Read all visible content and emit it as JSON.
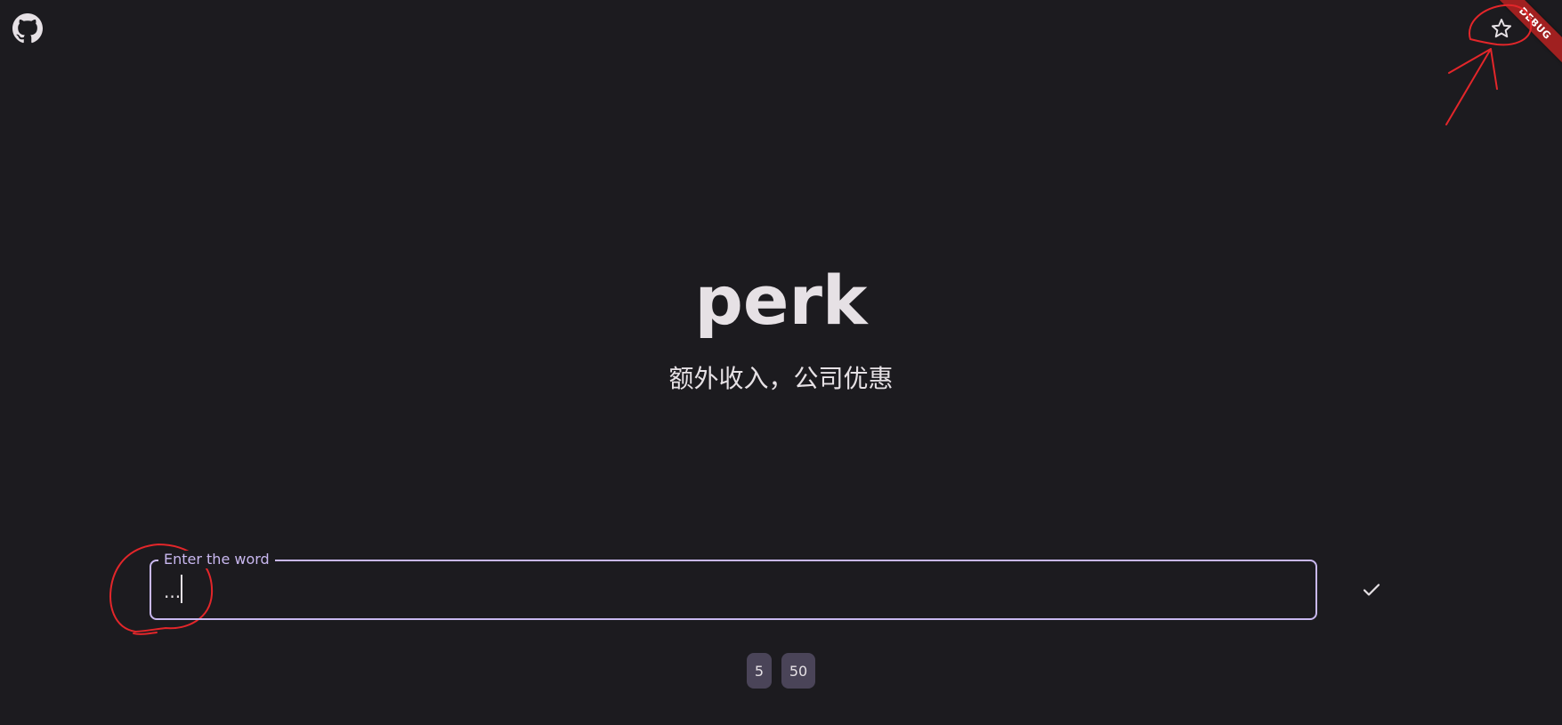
{
  "header": {
    "github_icon": "github-icon",
    "favorite_icon": "star-outline-icon",
    "debug_banner": "DEBUG"
  },
  "word": {
    "term": "perk",
    "meaning": "额外收入，公司优惠"
  },
  "answer_input": {
    "label": "Enter the word",
    "value": "..."
  },
  "submit": {
    "icon": "check-icon"
  },
  "count_options": [
    "5",
    "50"
  ],
  "colors": {
    "background": "#1c1b1f",
    "text": "#e6e1e5",
    "accent": "#c9b8f0",
    "chip": "#4a4458",
    "annotation": "#e3262a",
    "debug_banner": "#a02020"
  }
}
